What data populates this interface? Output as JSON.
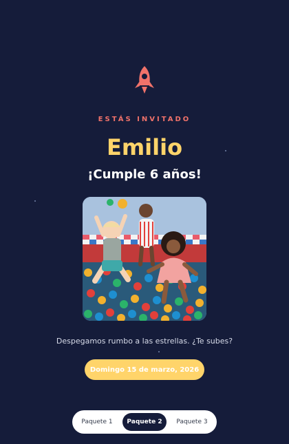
{
  "theme": {
    "background": "#151c3a",
    "accent_coral": "#f0726a",
    "accent_yellow": "#ffd46a"
  },
  "header": {
    "icon": "rocket-icon",
    "eyebrow": "ESTÁS INVITADO",
    "name": "Emilio",
    "subtitle": "¡Cumple 6 años!"
  },
  "photo": {
    "alt": "Niños jugando en una piscina de pelotas"
  },
  "tagline": "Despegamos rumbo a las estrellas. ¿Te subes?",
  "date_button": {
    "label": "Domingo 15 de marzo, 2026"
  },
  "packages": {
    "tabs": [
      {
        "label": "Paquete 1",
        "active": false
      },
      {
        "label": "Paquete 2",
        "active": true
      },
      {
        "label": "Paquete 3",
        "active": false
      }
    ]
  }
}
